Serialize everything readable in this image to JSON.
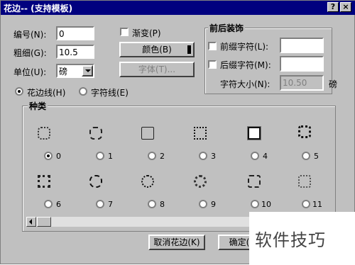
{
  "window": {
    "title": "花边-- (支持模板)",
    "help_label": "?",
    "close_label": "×"
  },
  "fields": {
    "number_label": "编号(N):",
    "number_value": "0",
    "weight_label": "粗细(G):",
    "weight_value": "10.5",
    "unit_label": "单位(U):",
    "unit_value": "磅"
  },
  "style": {
    "gradient_label": "渐变(P)",
    "color_button": "颜色(B)",
    "font_button": "字体(T)..."
  },
  "decoration": {
    "group_label": "前后装饰",
    "prefix_label": "前缀字符(L):",
    "prefix_value": "",
    "suffix_label": "后缀字符(M):",
    "suffix_value": "",
    "size_label": "字符大小(N):",
    "size_value": "10.50",
    "size_unit": "磅"
  },
  "mode": {
    "flower_line_label": "花边线(H)",
    "char_line_label": "字符线(E)",
    "selected": "flower_line"
  },
  "types": {
    "group_label": "种类",
    "selected": 0,
    "options": [
      "0",
      "1",
      "2",
      "3",
      "4",
      "5",
      "6",
      "7",
      "8",
      "9",
      "10",
      "11"
    ]
  },
  "buttons": {
    "cancel_label": "取消花边(K)",
    "ok_label": "确定("
  },
  "watermark": {
    "text": "软件技巧"
  }
}
